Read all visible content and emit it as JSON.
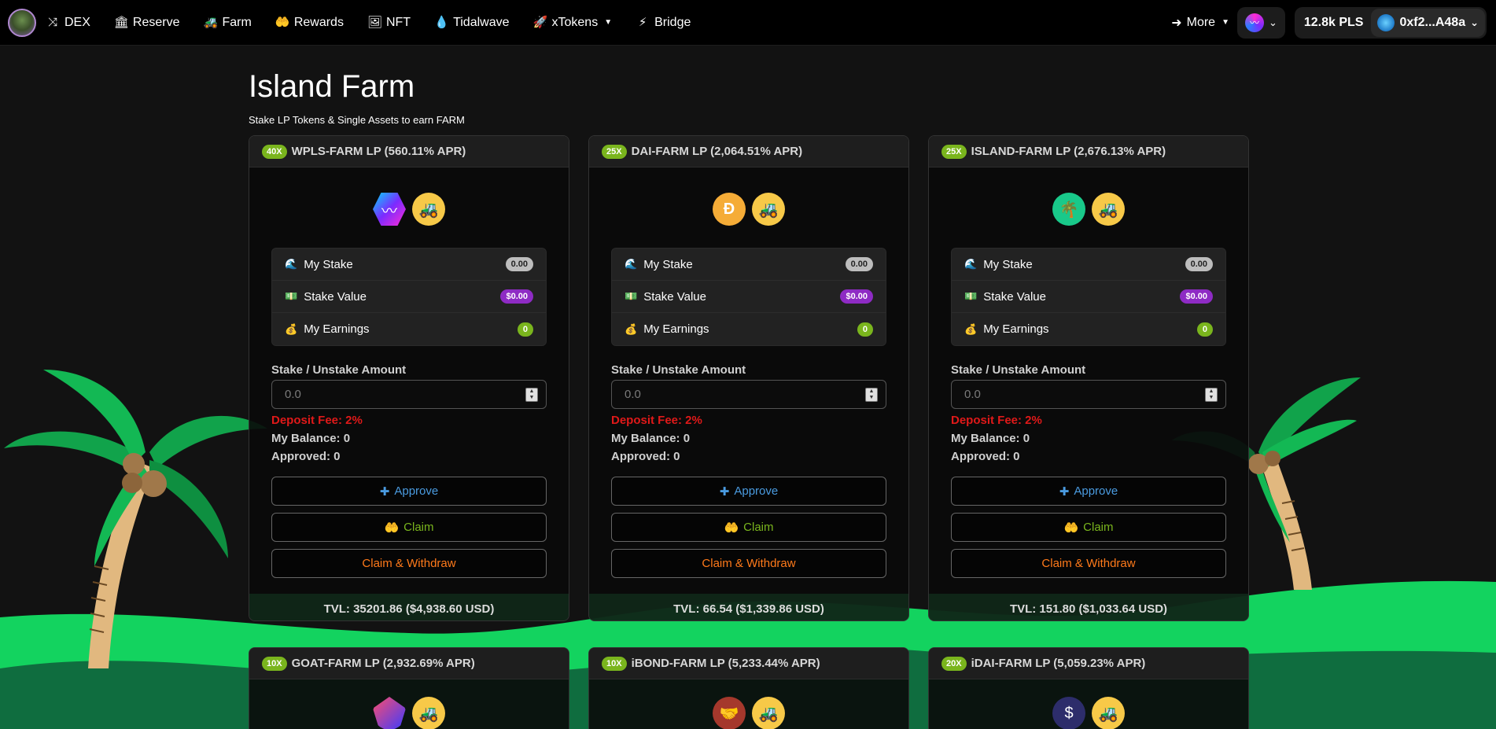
{
  "nav": {
    "items": [
      {
        "label": "DEX",
        "icon": "shuffle-icon",
        "glyph": "⤨"
      },
      {
        "label": "Reserve",
        "icon": "bank-icon",
        "glyph": "🏛"
      },
      {
        "label": "Farm",
        "icon": "tractor-icon",
        "glyph": "🚜"
      },
      {
        "label": "Rewards",
        "icon": "hand-coin-icon",
        "glyph": "🤲"
      },
      {
        "label": "NFT",
        "icon": "image-icon",
        "glyph": "🖼"
      },
      {
        "label": "Tidalwave",
        "icon": "droplet-icon",
        "glyph": "💧"
      },
      {
        "label": "xTokens",
        "icon": "rocket-icon",
        "glyph": "🚀",
        "dropdown": true
      },
      {
        "label": "Bridge",
        "icon": "bolt-icon",
        "glyph": "⚡"
      }
    ],
    "more_label": "More",
    "balance": "12.8k PLS",
    "address": "0xf2...A48a"
  },
  "page": {
    "title": "Island Farm",
    "subtitle": "Stake LP Tokens & Single Assets to earn FARM"
  },
  "labels": {
    "my_stake": "My Stake",
    "stake_value": "Stake Value",
    "my_earnings": "My Earnings",
    "amount_label": "Stake / Unstake Amount",
    "amount_placeholder": "0.0",
    "deposit_fee": "Deposit Fee: 2%",
    "my_balance": "My Balance: 0",
    "approved": "Approved: 0",
    "approve": "Approve",
    "claim": "Claim",
    "claim_withdraw": "Claim & Withdraw"
  },
  "farms": [
    {
      "multiplier": "40X",
      "name": "WPLS-FARM LP (560.11% APR)",
      "token": "pls",
      "my_stake": "0.00",
      "stake_value": "$0.00",
      "earnings": "0",
      "tvl": "TVL: 35201.86 ($4,938.60 USD)"
    },
    {
      "multiplier": "25X",
      "name": "DAI-FARM LP (2,064.51% APR)",
      "token": "dai",
      "my_stake": "0.00",
      "stake_value": "$0.00",
      "earnings": "0",
      "tvl": "TVL: 66.54 ($1,339.86 USD)"
    },
    {
      "multiplier": "25X",
      "name": "ISLAND-FARM LP (2,676.13% APR)",
      "token": "island",
      "my_stake": "0.00",
      "stake_value": "$0.00",
      "earnings": "0",
      "tvl": "TVL: 151.80 ($1,033.64 USD)"
    },
    {
      "multiplier": "10X",
      "name": "GOAT-FARM LP (2,932.69% APR)",
      "token": "goat"
    },
    {
      "multiplier": "10X",
      "name": "iBOND-FARM LP (5,233.44% APR)",
      "token": "ibond"
    },
    {
      "multiplier": "20X",
      "name": "iDAI-FARM LP (5,059.23% APR)",
      "token": "idai"
    }
  ]
}
